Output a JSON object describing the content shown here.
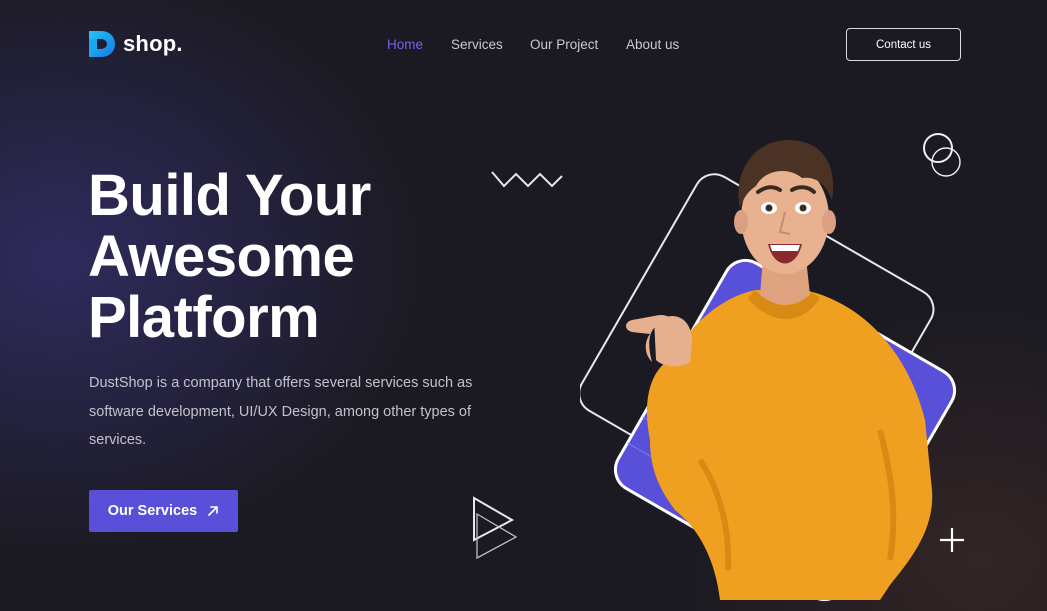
{
  "header": {
    "logo_text": "shop.",
    "nav": [
      {
        "label": "Home",
        "active": true
      },
      {
        "label": "Services",
        "active": false
      },
      {
        "label": "Our Project",
        "active": false
      },
      {
        "label": "About us",
        "active": false
      }
    ],
    "contact_label": "Contact us"
  },
  "hero": {
    "title_line1": "Build Your",
    "title_line2": "Awesome",
    "title_line3": "Platform",
    "description": "DustShop is a company that offers several services such as software development, UI/UX Design, among other types of services.",
    "cta_label": "Our Services"
  },
  "colors": {
    "accent": "#5a4fd8",
    "nav_active": "#6f66e8",
    "logo_blue": "#1aa8f0",
    "sweater": "#f0a020",
    "background": "#1b1a22"
  },
  "icons": {
    "cta_icon": "arrow-up-right-icon",
    "logo_icon": "d-logo-icon"
  }
}
